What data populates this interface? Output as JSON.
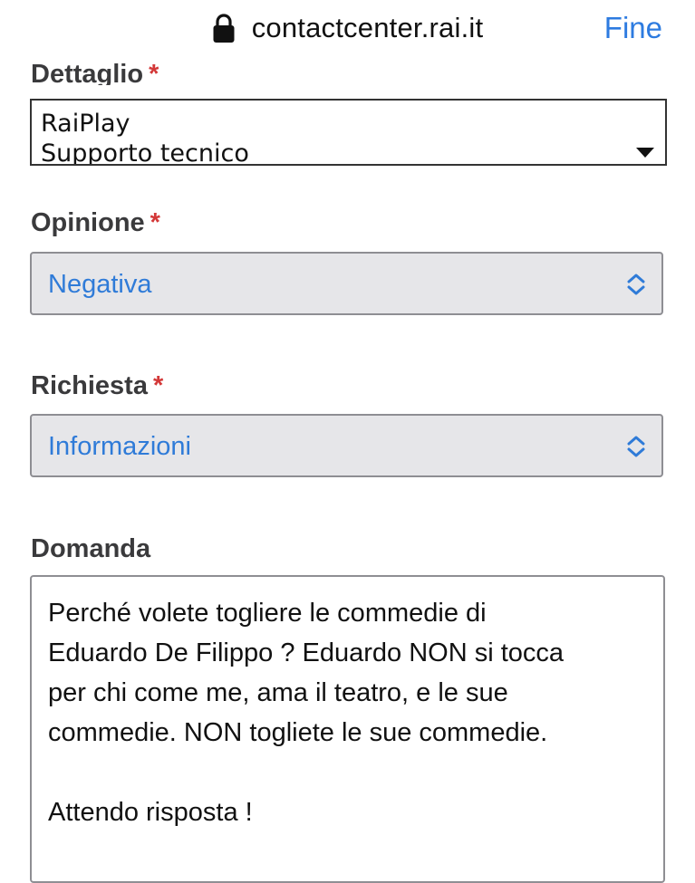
{
  "browser": {
    "url": "contactcenter.rai.it",
    "done_label": "Fine"
  },
  "form": {
    "dettaglio": {
      "label": "Dettaglio",
      "required_mark": "*",
      "options": [
        "RaiPlay",
        "Supporto tecnico"
      ]
    },
    "opinione": {
      "label": "Opinione",
      "required_mark": "*",
      "value": "Negativa"
    },
    "richiesta": {
      "label": "Richiesta",
      "required_mark": "*",
      "value": "Informazioni"
    },
    "domanda": {
      "label": "Domanda",
      "lines": [
        "Perché volete togliere le commedie di",
        "Eduardo De Filippo ? Eduardo NON si tocca",
        "per chi come me, ama il teatro, e le sue",
        "commedie. NON togliete le sue commedie.",
        "Attendo risposta !"
      ]
    }
  },
  "colors": {
    "link_blue": "#2d7be0",
    "select_value_blue": "#2f7bd8",
    "required_red": "#d33838",
    "select_bg": "#e6e6e9"
  },
  "icons": {
    "lock": "lock-icon",
    "caret": "caret-down-icon",
    "chevron": "chevron-up-down-icon"
  }
}
